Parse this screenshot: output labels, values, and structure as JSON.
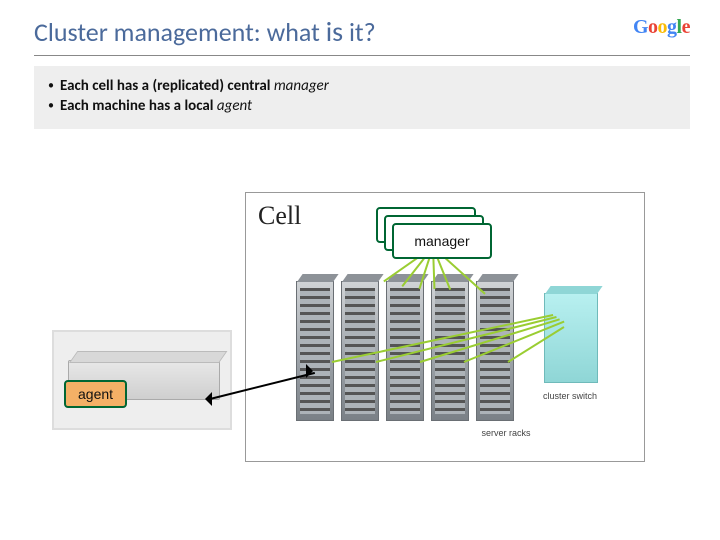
{
  "header": {
    "title_prefix": "Cluster management: what ",
    "title_is": "is",
    "title_suffix": " it?"
  },
  "logo": {
    "g1": "G",
    "o1": "o",
    "o2": "o",
    "g2": "g",
    "l": "l",
    "e": "e"
  },
  "bullets": {
    "b1a": "Each cell has a (replicated) central ",
    "b1b": "manager",
    "b2a": "Each machine has a local ",
    "b2b": "agent"
  },
  "diagram": {
    "cell_label": "Cell",
    "manager_label": "manager",
    "agent_label": "agent",
    "switch_label": "cluster switch",
    "racks_label": "server racks"
  },
  "colors": {
    "green": "#9acd32",
    "darkgreen": "#006633",
    "orange": "#f4b066",
    "title_blue": "#4b6a9b"
  }
}
